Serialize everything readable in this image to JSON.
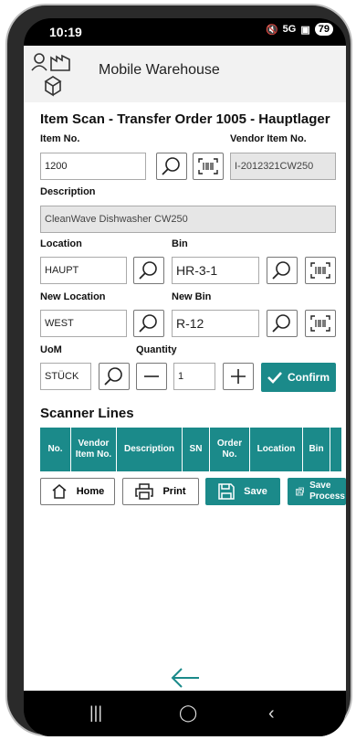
{
  "status": {
    "time": "10:19",
    "signal": "5G",
    "battery": "79"
  },
  "header": {
    "title": "Mobile Warehouse"
  },
  "page": {
    "title": "Item Scan - Transfer Order 1005 - Hauptlager"
  },
  "form": {
    "item_no_label": "Item No.",
    "item_no_value": "1200",
    "vendor_item_no_label": "Vendor Item No.",
    "vendor_item_no_value": "I-2012321CW250",
    "description_label": "Description",
    "description_value": "CleanWave Dishwasher CW250",
    "location_label": "Location",
    "location_value": "HAUPT",
    "bin_label": "Bin",
    "bin_value": "HR-3-1",
    "new_location_label": "New Location",
    "new_location_value": "WEST",
    "new_bin_label": "New Bin",
    "new_bin_value": "R-12",
    "uom_label": "UoM",
    "uom_value": "STÜCK",
    "quantity_label": "Quantity",
    "quantity_value": "1",
    "confirm_label": "Confirm"
  },
  "scanner_lines": {
    "title": "Scanner Lines",
    "columns": [
      "No.",
      "Vendor Item No.",
      "Description",
      "SN",
      "Order No.",
      "Location",
      "Bin"
    ]
  },
  "actions": {
    "home": "Home",
    "print": "Print",
    "save": "Save",
    "save_process": "Save Process"
  },
  "colors": {
    "accent": "#1b8a8a"
  }
}
